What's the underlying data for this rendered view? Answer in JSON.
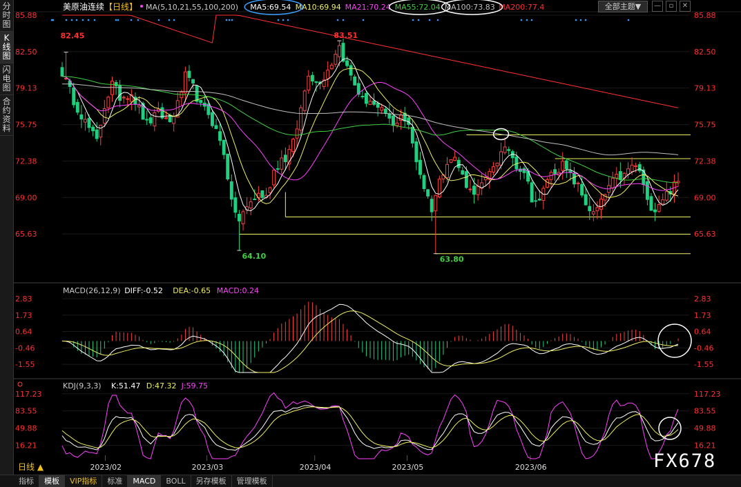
{
  "sidebar": {
    "tabs": [
      {
        "label": "分时图",
        "active": false
      },
      {
        "label": "K线图",
        "active": true
      },
      {
        "label": "闪电图",
        "active": false
      },
      {
        "label": "合约资料",
        "active": false
      }
    ]
  },
  "bottom_tabs": [
    {
      "label": "指标",
      "active": false,
      "vip": false
    },
    {
      "label": "模板",
      "active": true,
      "vip": false
    },
    {
      "label": "VIP指标",
      "active": false,
      "vip": true
    },
    {
      "label": "标准",
      "active": false,
      "vip": false
    },
    {
      "label": "MACD",
      "active": true,
      "vip": false
    },
    {
      "label": "BOLL",
      "active": false,
      "vip": false
    },
    {
      "label": "另存模板",
      "active": false,
      "vip": false
    },
    {
      "label": "管理模板",
      "active": false,
      "vip": false
    }
  ],
  "period_label": "日线 ▲",
  "watermark": "FX678",
  "theme_button": "全部主题▼",
  "colors": {
    "up": "#ff4040",
    "down": "#20d080",
    "ma5": "#ffffff",
    "ma10": "#f0f060",
    "ma21": "#ff40ff",
    "ma55": "#40d040",
    "ma100": "#c0c0c0",
    "ma200": "#ff3030",
    "axis_text": "#ff3030"
  },
  "chart_data": [
    {
      "type": "candlestick",
      "title": "美原油连续",
      "period_tag": "【日线】",
      "legend": [
        {
          "text": "MA(5,10,21,55,100,200)",
          "color": "#cccccc"
        },
        {
          "text": "MA5:69.54",
          "color": "#ffffff"
        },
        {
          "text": "MA10:69.94",
          "color": "#f0f060"
        },
        {
          "text": "MA21:70.24",
          "color": "#ff40ff"
        },
        {
          "text": "MA55:72.04",
          "color": "#40d040"
        },
        {
          "text": "MA100:73.83",
          "color": "#c0c0c0"
        },
        {
          "text": "MA200:77.4",
          "color": "#ff3030"
        }
      ],
      "y_ticks": [
        "85.88",
        "82.50",
        "79.13",
        "75.75",
        "72.38",
        "69.00",
        "65.63"
      ],
      "ylim": [
        62.25,
        85.88
      ],
      "x_ticks": [
        "2023/02",
        "2023/03",
        "2023/04",
        "2023/05",
        "2023/06"
      ],
      "annotations": [
        {
          "text": "82.45",
          "value": 82.45,
          "color": "#ff3030"
        },
        {
          "text": "83.51",
          "value": 83.51,
          "color": "#ff3030"
        },
        {
          "text": "64.10",
          "value": 64.1,
          "color": "#40d040"
        },
        {
          "text": "63.80",
          "value": 63.8,
          "color": "#40d040"
        }
      ],
      "support_levels": [
        74.8,
        72.6,
        67.2,
        65.6,
        63.8
      ],
      "anchors": [
        [
          0,
          80.6
        ],
        [
          3,
          78.0
        ],
        [
          6,
          76.0
        ],
        [
          9,
          74.2
        ],
        [
          11,
          77.5
        ],
        [
          13,
          79.5
        ],
        [
          15,
          78.3
        ],
        [
          18,
          78.7
        ],
        [
          20,
          77.2
        ],
        [
          22,
          75.8
        ],
        [
          25,
          76.8
        ],
        [
          28,
          76.0
        ],
        [
          30,
          77.6
        ],
        [
          32,
          80.2
        ],
        [
          34,
          79.2
        ],
        [
          36,
          77.4
        ],
        [
          38,
          76.8
        ],
        [
          40,
          75.2
        ],
        [
          42,
          73.2
        ],
        [
          43,
          71.0
        ],
        [
          44,
          68.4
        ],
        [
          45,
          67.8
        ],
        [
          46,
          66.8
        ],
        [
          47,
          67.5
        ],
        [
          49,
          68.6
        ],
        [
          51,
          69.3
        ],
        [
          53,
          69.0
        ],
        [
          55,
          71.5
        ],
        [
          57,
          72.6
        ],
        [
          58,
          72.6
        ],
        [
          60,
          74.0
        ],
        [
          61,
          75.5
        ],
        [
          62,
          77.2
        ],
        [
          64,
          80.6
        ],
        [
          66,
          79.6
        ],
        [
          68,
          80.2
        ],
        [
          70,
          81.5
        ],
        [
          71,
          82.5
        ],
        [
          72,
          83.0
        ],
        [
          73,
          82.0
        ],
        [
          74,
          81.0
        ],
        [
          76,
          79.5
        ],
        [
          78,
          78.0
        ],
        [
          80,
          78.0
        ],
        [
          82,
          77.0
        ],
        [
          84,
          76.8
        ],
        [
          86,
          75.5
        ],
        [
          88,
          76.8
        ],
        [
          90,
          75.5
        ],
        [
          92,
          72.5
        ],
        [
          94,
          70.0
        ],
        [
          96,
          68.0
        ],
        [
          98,
          70.5
        ],
        [
          100,
          72.5
        ],
        [
          102,
          72.6
        ],
        [
          104,
          71.0
        ],
        [
          106,
          69.6
        ],
        [
          108,
          69.8
        ],
        [
          110,
          70.5
        ],
        [
          112,
          72.0
        ],
        [
          114,
          73.0
        ],
        [
          116,
          73.5
        ],
        [
          118,
          72.0
        ],
        [
          120,
          71.5
        ],
        [
          122,
          69.0
        ],
        [
          124,
          68.5
        ],
        [
          126,
          70.8
        ],
        [
          128,
          71.5
        ],
        [
          130,
          72.0
        ],
        [
          132,
          71.0
        ],
        [
          134,
          70.0
        ],
        [
          136,
          68.5
        ],
        [
          138,
          67.4
        ],
        [
          140,
          68.5
        ],
        [
          142,
          70.0
        ],
        [
          144,
          70.8
        ],
        [
          146,
          71.0
        ],
        [
          148,
          72.0
        ],
        [
          150,
          71.5
        ],
        [
          152,
          68.5
        ],
        [
          154,
          68.0
        ],
        [
          156,
          69.0
        ],
        [
          158,
          69.7
        ],
        [
          160,
          70.4
        ]
      ],
      "pivots": [
        [
          1,
          82.45
        ],
        [
          46,
          64.1
        ],
        [
          72,
          83.51
        ],
        [
          97,
          63.8
        ]
      ],
      "circles": [
        {
          "ref": "ma5_legend"
        },
        {
          "ref": "ma55_ma100_legend"
        },
        {
          "ref": "peak_high"
        }
      ]
    },
    {
      "type": "macd",
      "legend": [
        {
          "text": "MACD(26,12,9)",
          "color": "#cccccc"
        },
        {
          "text": "DIFF:-0.52",
          "color": "#ffffff"
        },
        {
          "text": "DEA:-0.65",
          "color": "#f0f060"
        },
        {
          "text": "MACD:0.24",
          "color": "#ff40ff"
        }
      ],
      "y_ticks": [
        "2.83",
        "1.73",
        "0.64",
        "-0.46",
        "-1.55"
      ],
      "ylim": [
        -2.1,
        3.2
      ],
      "values": {
        "diff": -0.52,
        "dea": -0.65,
        "macd": 0.24
      }
    },
    {
      "type": "kdj",
      "legend": [
        {
          "text": "KDJ(9,3,3)",
          "color": "#cccccc"
        },
        {
          "text": "K:51.47",
          "color": "#ffffff"
        },
        {
          "text": "D:47.32",
          "color": "#f0f060"
        },
        {
          "text": "J:59.75",
          "color": "#ff40ff"
        }
      ],
      "y_ticks": [
        "117.23",
        "83.55",
        "49.88",
        "16.21"
      ],
      "ylim": [
        -10,
        125
      ],
      "values": {
        "k": 51.47,
        "d": 47.32,
        "j": 59.75
      }
    }
  ]
}
